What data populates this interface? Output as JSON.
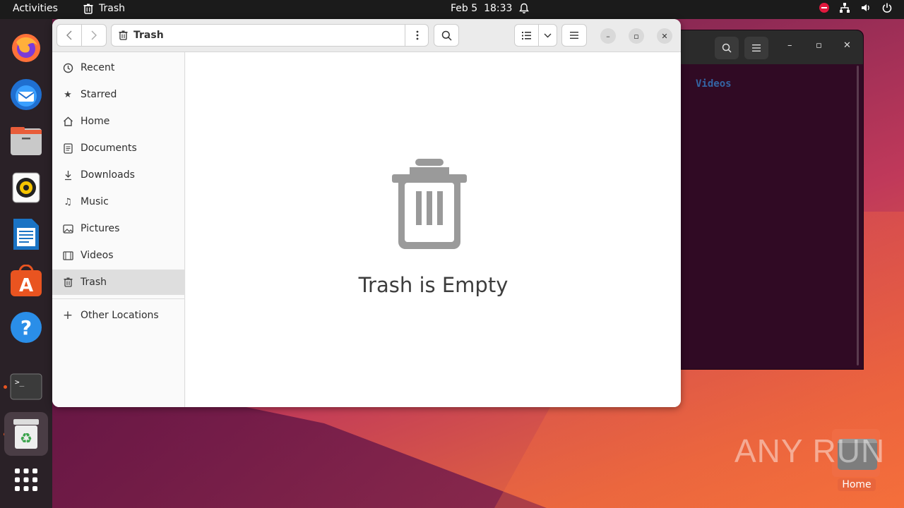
{
  "topbar": {
    "activities": "Activities",
    "app_name": "Trash",
    "date": "Feb 5",
    "time": "18:33"
  },
  "dock": {
    "items": [
      "firefox-icon",
      "thunderbird-icon",
      "files-icon",
      "rhythmbox-icon",
      "writer-icon",
      "app-center-icon",
      "help-icon",
      "terminal-icon",
      "trash-icon",
      "show-apps-icon"
    ]
  },
  "terminal": {
    "text": "Videos"
  },
  "file_manager": {
    "path_label": "Trash",
    "sidebar": [
      {
        "label": "Recent",
        "icon": "clock-icon"
      },
      {
        "label": "Starred",
        "icon": "star-icon"
      },
      {
        "label": "Home",
        "icon": "home-icon"
      },
      {
        "label": "Documents",
        "icon": "document-icon"
      },
      {
        "label": "Downloads",
        "icon": "download-icon"
      },
      {
        "label": "Music",
        "icon": "music-icon"
      },
      {
        "label": "Pictures",
        "icon": "picture-icon"
      },
      {
        "label": "Videos",
        "icon": "video-icon"
      },
      {
        "label": "Trash",
        "icon": "trash-icon",
        "active": true
      },
      {
        "label": "Other Locations",
        "icon": "plus-icon"
      }
    ],
    "empty_message": "Trash is Empty"
  },
  "desktop": {
    "watermark": "ANY RUN",
    "home_label": "Home"
  },
  "colors": {
    "accent": "#e95420",
    "terminal_bg": "#300a24",
    "dir_color": "#3465a4"
  }
}
